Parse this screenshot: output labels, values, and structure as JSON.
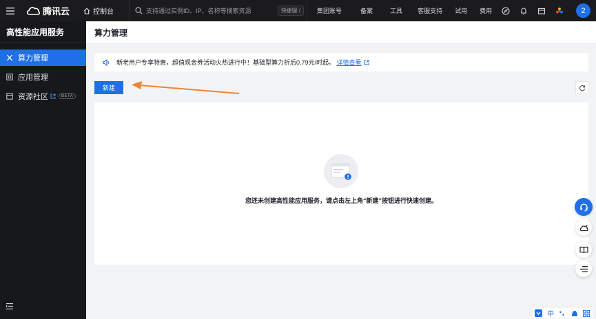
{
  "topbar": {
    "brand": "腾讯云",
    "console": "控制台",
    "search_placeholder": "支持通过实例ID、IP、名称等搜索资源",
    "shortcut": "快捷键 /",
    "nav": [
      "集团账号",
      "备案",
      "工具",
      "客服支持",
      "试用",
      "费用"
    ],
    "user_initial": "2"
  },
  "sidebar": {
    "title": "高性能应用服务",
    "items": [
      {
        "label": "算力管理",
        "icon": "compute-icon"
      },
      {
        "label": "应用管理",
        "icon": "app-icon"
      },
      {
        "label": "资源社区",
        "icon": "community-icon"
      }
    ],
    "beta": "BETA"
  },
  "main": {
    "title": "算力管理",
    "notice": "新老用户专享特惠，超值现金券活动火热进行中！基础型算力折后0.79元/时起。",
    "notice_link": "详情查看",
    "new_button": "新建",
    "empty_text": "您还未创建高性能应用服务，请点击左上角“新建”按钮进行快速创建。"
  },
  "ime": {
    "lang": "中"
  },
  "colors": {
    "accent": "#1f6fe6",
    "topbar": "#1b1b1e",
    "sidebar": "#17181b",
    "arrow": "#f08333"
  }
}
